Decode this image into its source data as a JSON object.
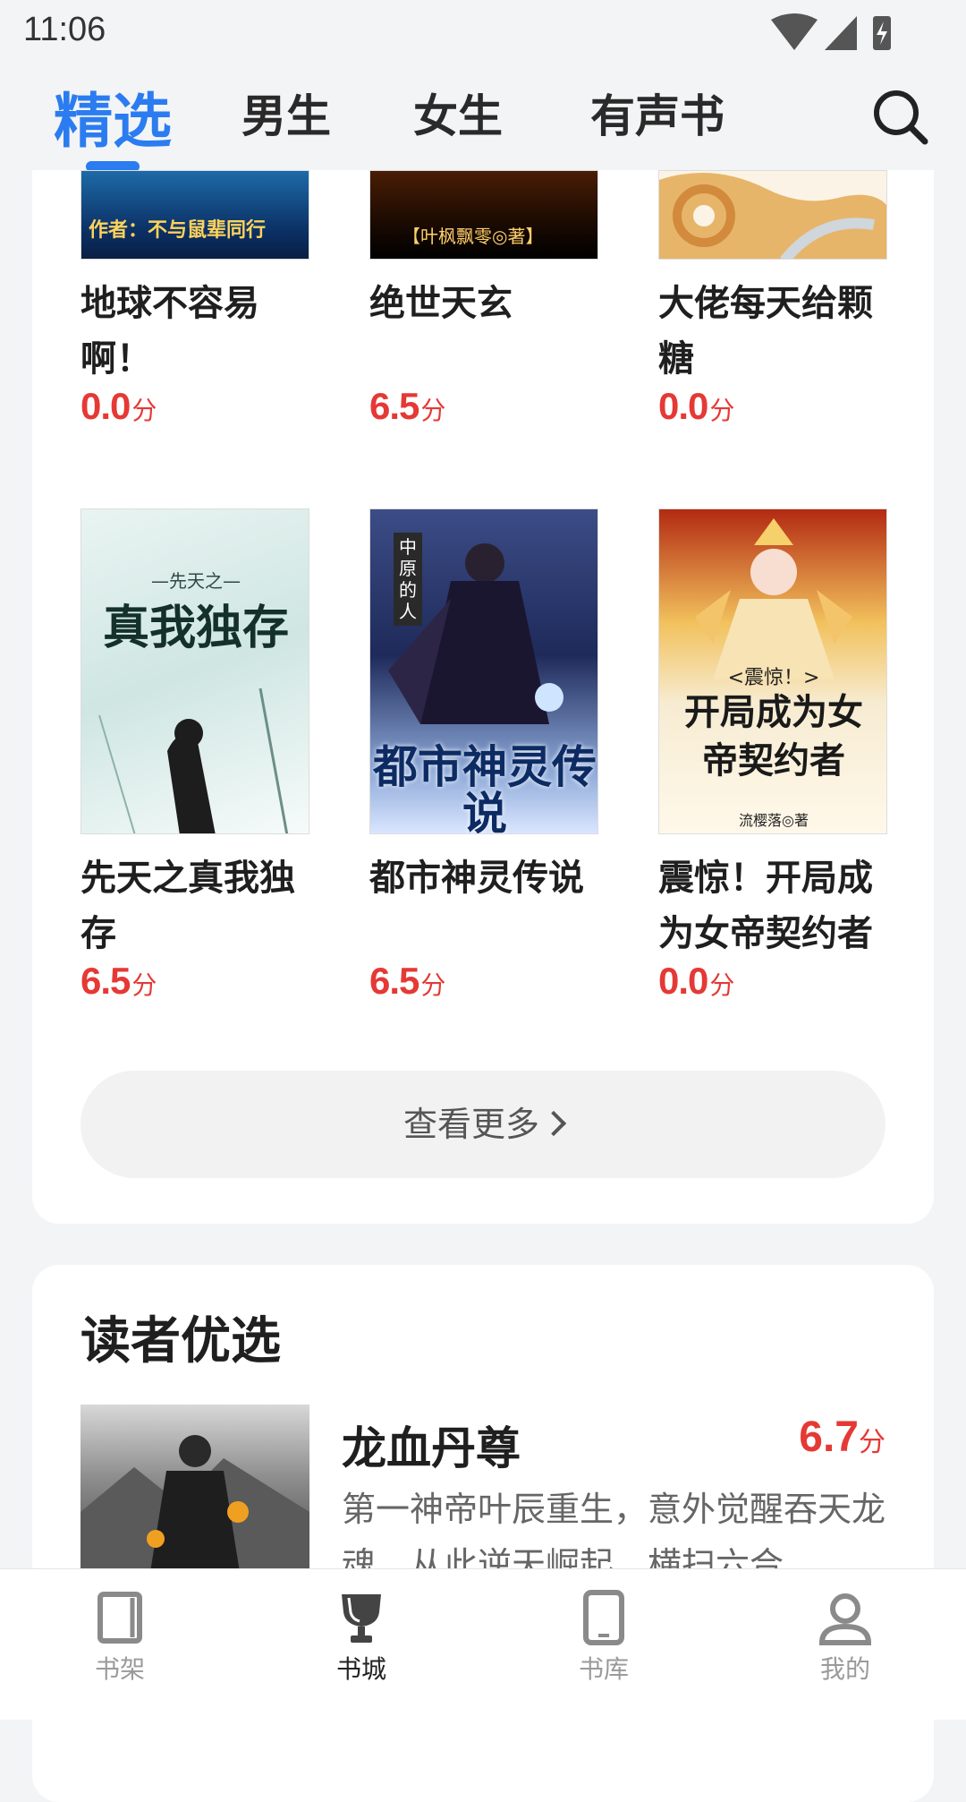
{
  "status": {
    "time": "11:06"
  },
  "tabs": [
    {
      "label": "精选",
      "active": true
    },
    {
      "label": "男生"
    },
    {
      "label": "女生"
    },
    {
      "label": "有声书"
    }
  ],
  "books_row1": [
    {
      "title": "地球不容易啊！",
      "score": "0.0",
      "unit": "分",
      "cover_text": "作者：不与鼠辈同行"
    },
    {
      "title": "绝世天玄",
      "score": "6.5",
      "unit": "分",
      "cover_text": "【叶枫飘零◎著】"
    },
    {
      "title": "大佬每天给颗糖",
      "score": "0.0",
      "unit": "分",
      "cover_text": ""
    }
  ],
  "books_row2": [
    {
      "title": "先天之真我独存",
      "score": "6.5",
      "unit": "分",
      "cover_text": "真我独存",
      "cover_sub": "—先天之—"
    },
    {
      "title": "都市神灵传说",
      "score": "6.5",
      "unit": "分",
      "cover_text": "都市神灵传说",
      "cover_sub": "中原的人"
    },
    {
      "title": "震惊！开局成为女帝契约者",
      "score": "0.0",
      "unit": "分",
      "cover_text": "开局成为女帝契约者",
      "cover_sub": "<震惊！>",
      "cover_author": "流樱落◎著"
    }
  ],
  "more_button": "查看更多",
  "featured": {
    "section_title": "读者优选",
    "title": "龙血丹尊",
    "score": "6.7",
    "unit": "分",
    "description": "第一神帝叶辰重生，意外觉醒吞天龙魂，从此逆天崛起，横扫六合"
  },
  "bottom_nav": [
    {
      "label": "书架",
      "icon": "book-icon"
    },
    {
      "label": "书城",
      "icon": "trophy-icon",
      "active": true
    },
    {
      "label": "书库",
      "icon": "tablet-icon"
    },
    {
      "label": "我的",
      "icon": "user-icon"
    }
  ],
  "colors": {
    "accent": "#2b7cf0",
    "score": "#e53935"
  }
}
